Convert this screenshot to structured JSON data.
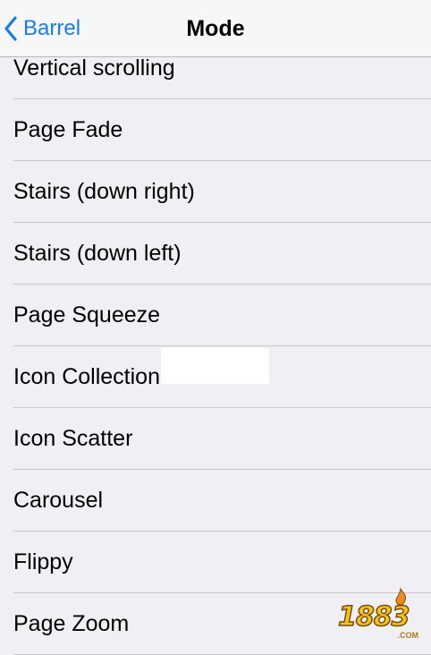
{
  "navbar": {
    "back_label": "Barrel",
    "title": "Mode"
  },
  "list": {
    "items": [
      {
        "label": "Vertical scrolling"
      },
      {
        "label": "Page Fade"
      },
      {
        "label": "Stairs (down right)"
      },
      {
        "label": "Stairs (down left)"
      },
      {
        "label": "Page Squeeze"
      },
      {
        "label": "Icon Collection"
      },
      {
        "label": "Icon Scatter"
      },
      {
        "label": "Carousel"
      },
      {
        "label": "Flippy"
      },
      {
        "label": "Page Zoom"
      }
    ]
  },
  "watermark": {
    "text": "1883",
    "sub": ".COM"
  },
  "colors": {
    "accent": "#1a7bf0",
    "background": "#efeff4",
    "navbar": "#f7f7f7",
    "separator": "#c8c7cc"
  },
  "icons": {
    "back": "chevron-left-icon"
  }
}
